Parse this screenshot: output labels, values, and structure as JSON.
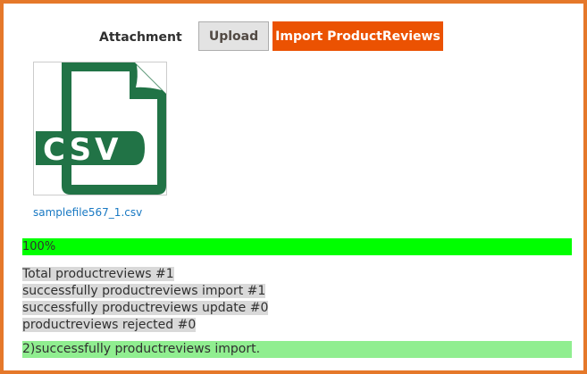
{
  "form": {
    "attachment_label": "Attachment",
    "upload_label": "Upload",
    "import_label": "Import ProductReviews"
  },
  "file": {
    "icon": "csv-file-icon",
    "icon_text": "CSV",
    "icon_color": "#217346",
    "name": "samplefile567_1.csv"
  },
  "progress": {
    "percent": 100,
    "label": "100%",
    "color": "#00ff00"
  },
  "summary": [
    "Total productreviews #1",
    "successfully productreviews import #1",
    "successfully productreviews update #0",
    "productreviews rejected #0"
  ],
  "result": {
    "message": "2)successfully productreviews import.",
    "color": "#90ee90"
  },
  "colors": {
    "frame_border": "#e5782a",
    "primary_button": "#eb5202",
    "link": "#1979c3"
  }
}
